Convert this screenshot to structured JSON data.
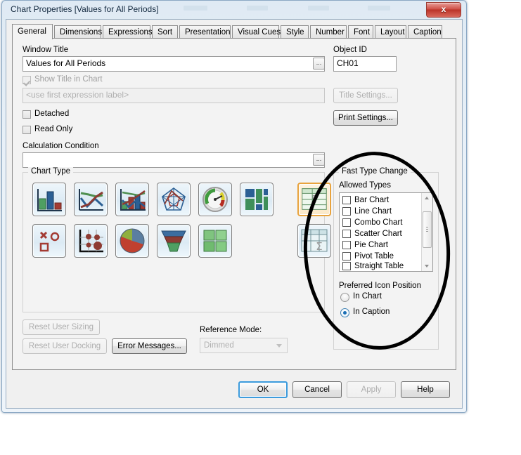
{
  "window": {
    "title": "Chart Properties [Values for All Periods]",
    "close_label": "x"
  },
  "tabs": [
    {
      "label": "General",
      "active": true
    },
    {
      "label": "Dimensions",
      "active": false
    },
    {
      "label": "Expressions",
      "active": false
    },
    {
      "label": "Sort",
      "active": false
    },
    {
      "label": "Presentation",
      "active": false
    },
    {
      "label": "Visual Cues",
      "active": false
    },
    {
      "label": "Style",
      "active": false
    },
    {
      "label": "Number",
      "active": false
    },
    {
      "label": "Font",
      "active": false
    },
    {
      "label": "Layout",
      "active": false
    },
    {
      "label": "Caption",
      "active": false
    }
  ],
  "general": {
    "window_title_label": "Window Title",
    "window_title_value": "Values for All Periods",
    "window_title_browse": "...",
    "show_title_label": "Show Title in Chart",
    "show_title_checked": true,
    "title_expression_placeholder": "<use first expression label>",
    "detached_label": "Detached",
    "detached_checked": false,
    "read_only_label": "Read Only",
    "read_only_checked": false,
    "calc_condition_label": "Calculation Condition",
    "calc_condition_value": "",
    "calc_condition_browse": "...",
    "object_id_label": "Object ID",
    "object_id_value": "CH01",
    "title_settings_label": "Title Settings...",
    "title_settings_enabled": false,
    "print_settings_label": "Print Settings...",
    "print_settings_enabled": true
  },
  "chart_type": {
    "group_label": "Chart Type",
    "icons": [
      {
        "name": "bar-chart",
        "selected": false
      },
      {
        "name": "line-chart",
        "selected": false
      },
      {
        "name": "combo-chart",
        "selected": false
      },
      {
        "name": "radar-chart",
        "selected": false
      },
      {
        "name": "gauge-chart",
        "selected": false
      },
      {
        "name": "block-chart",
        "selected": false
      },
      {
        "name": "straight-table",
        "selected": true
      },
      {
        "name": "scatter-chart",
        "selected": false
      },
      {
        "name": "grid-chart",
        "selected": false
      },
      {
        "name": "pie-chart",
        "selected": false
      },
      {
        "name": "funnel-chart",
        "selected": false
      },
      {
        "name": "mekko-chart",
        "selected": false
      },
      {
        "name": "pivot-table",
        "selected": false
      }
    ]
  },
  "fast_type_change": {
    "group_label": "Fast Type Change",
    "allowed_types_label": "Allowed Types",
    "allowed_types": [
      {
        "label": "Bar Chart",
        "checked": false
      },
      {
        "label": "Line Chart",
        "checked": false
      },
      {
        "label": "Combo Chart",
        "checked": false
      },
      {
        "label": "Scatter Chart",
        "checked": false
      },
      {
        "label": "Pie Chart",
        "checked": false
      },
      {
        "label": "Pivot Table",
        "checked": false
      },
      {
        "label": "Straight Table",
        "checked": false
      }
    ],
    "preferred_icon_position_label": "Preferred Icon Position",
    "icon_position_options": [
      {
        "label": "In Chart",
        "selected": false
      },
      {
        "label": "In Caption",
        "selected": true
      }
    ]
  },
  "footer_controls": {
    "reset_user_sizing_label": "Reset User Sizing",
    "reset_user_sizing_enabled": false,
    "reset_user_docking_label": "Reset User Docking",
    "reset_user_docking_enabled": false,
    "error_messages_label": "Error Messages...",
    "error_messages_enabled": true,
    "reference_mode_label": "Reference Mode:",
    "reference_mode_value": "Dimmed"
  },
  "dialog_buttons": [
    {
      "label": "OK",
      "enabled": true,
      "default": true
    },
    {
      "label": "Cancel",
      "enabled": true,
      "default": false
    },
    {
      "label": "Apply",
      "enabled": false,
      "default": false
    },
    {
      "label": "Help",
      "enabled": true,
      "default": false
    }
  ],
  "annotation": {
    "shape": "ellipse",
    "color": "#000000"
  }
}
